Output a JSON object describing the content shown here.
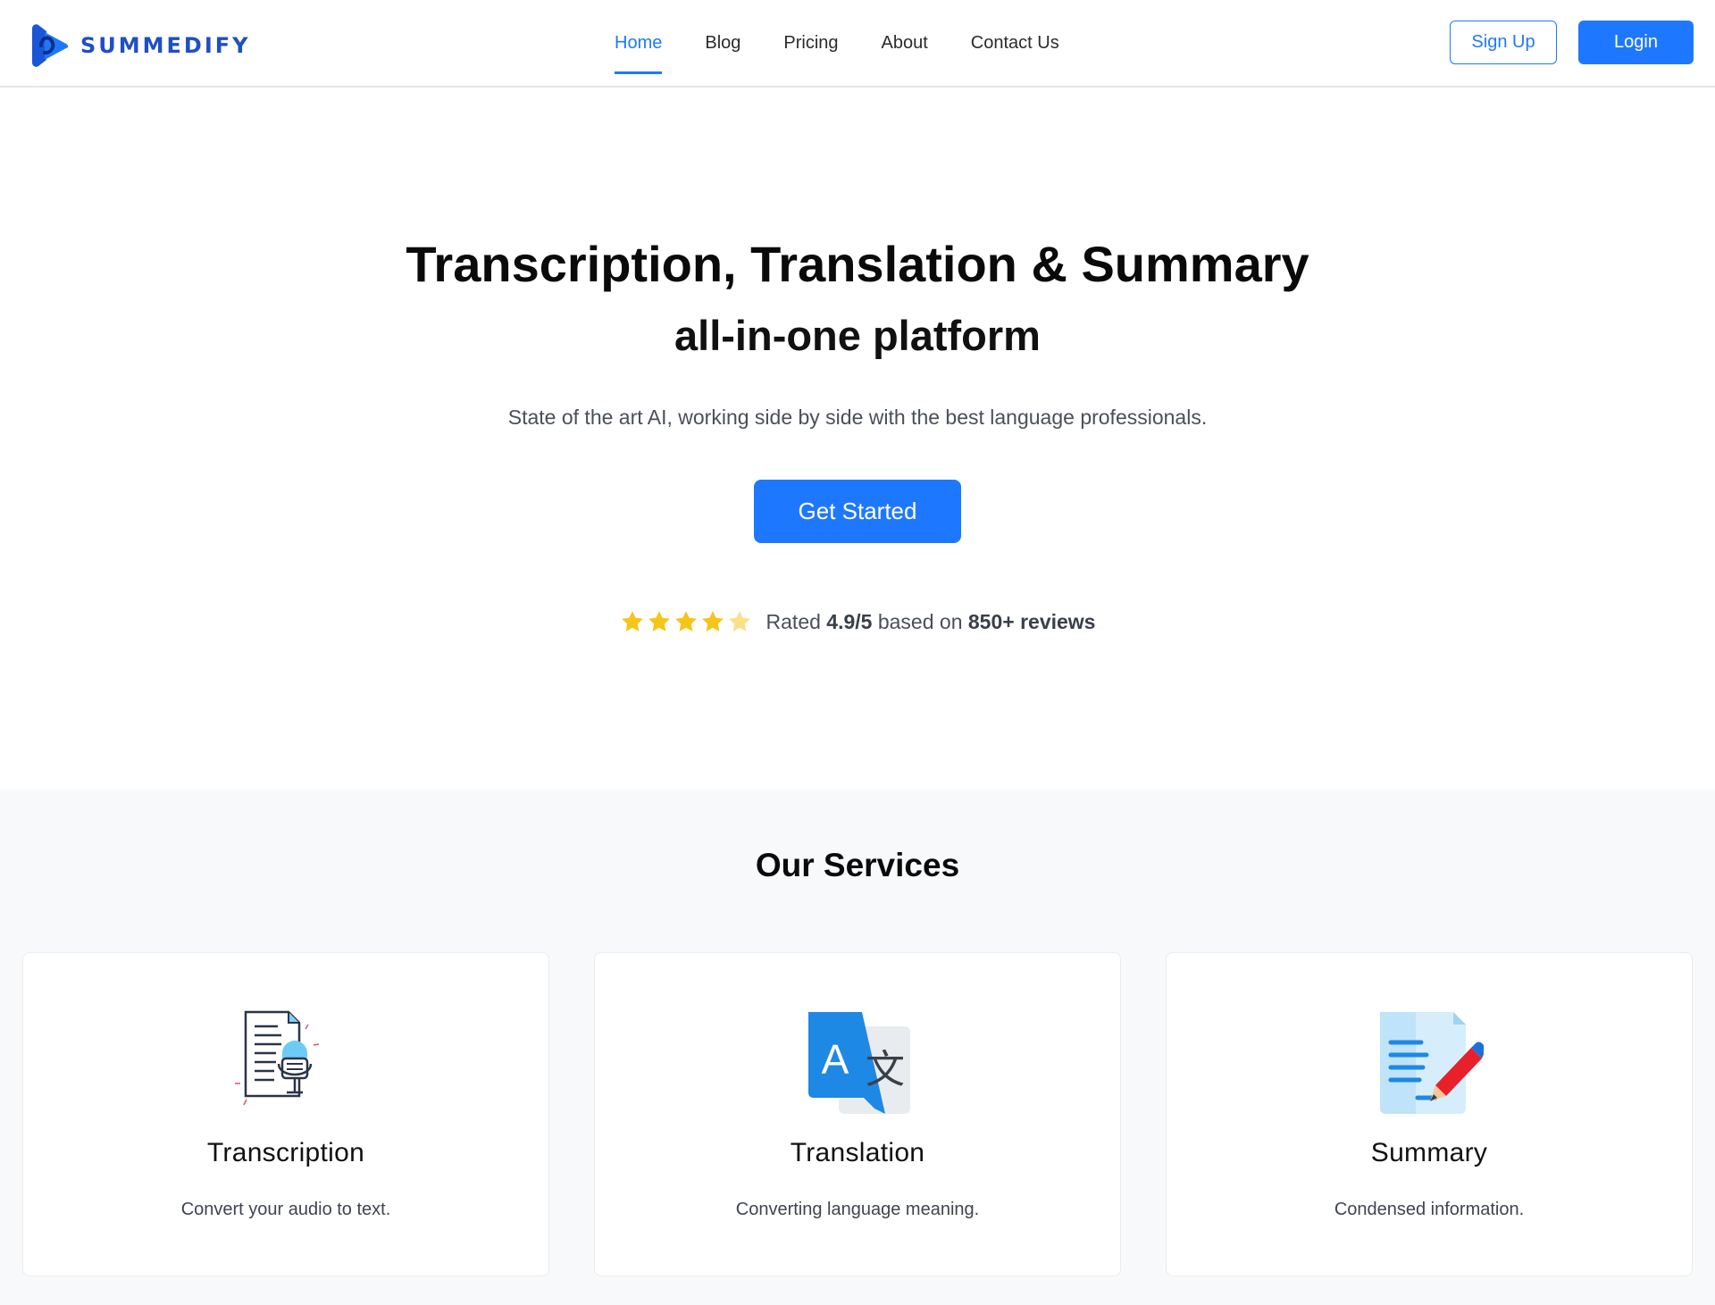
{
  "brand": {
    "name": "SUMMEDIFY",
    "logo_icon": "play-wave-logo-icon",
    "color": "#1f4fc4"
  },
  "nav": {
    "items": [
      {
        "label": "Home",
        "active": true
      },
      {
        "label": "Blog",
        "active": false
      },
      {
        "label": "Pricing",
        "active": false
      },
      {
        "label": "About",
        "active": false
      },
      {
        "label": "Contact Us",
        "active": false
      }
    ]
  },
  "auth": {
    "signup_label": "Sign Up",
    "login_label": "Login"
  },
  "hero": {
    "title": "Transcription, Translation & Summary",
    "subtitle": "all-in-one platform",
    "description": "State of the art AI, working side by side with the best language professionals.",
    "cta_label": "Get Started"
  },
  "rating": {
    "stars_filled": 4,
    "stars_total": 5,
    "prefix": "Rated",
    "score": "4.9/5",
    "middle": "based on",
    "reviews": "850+ reviews"
  },
  "services": {
    "title": "Our Services",
    "items": [
      {
        "title": "Transcription",
        "description": "Convert your audio to text.",
        "icon": "document-microphone-icon"
      },
      {
        "title": "Translation",
        "description": "Converting language meaning.",
        "icon": "translate-icon"
      },
      {
        "title": "Summary",
        "description": "Condensed information.",
        "icon": "document-pencil-icon"
      }
    ]
  },
  "colors": {
    "accent": "#1e78ff",
    "star": "#f5c518",
    "section_bg": "#f8f9fb"
  }
}
